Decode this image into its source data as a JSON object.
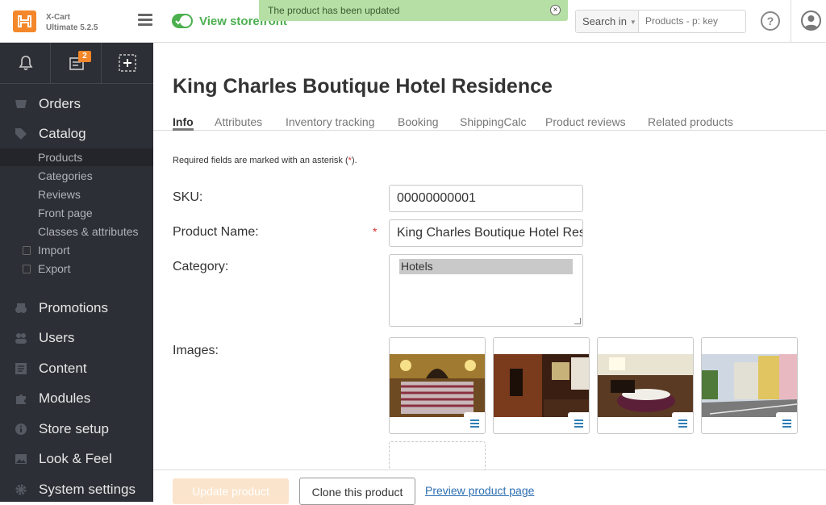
{
  "header": {
    "brand_line1": "X-Cart",
    "brand_line2": "Ultimate 5.2.5",
    "storefront_label": "View storefront",
    "notice": "The product has been updated",
    "notice_close": "×",
    "search_scope": "Search in",
    "search_placeholder": "Products - p: key",
    "help_label": "?"
  },
  "quick_bar": {
    "badge_count": "2"
  },
  "sidebar": {
    "items": [
      {
        "label": "Orders",
        "icon": "orders-icon"
      },
      {
        "label": "Catalog",
        "icon": "tag-icon"
      },
      {
        "label": "Promotions",
        "icon": "promotions-icon"
      },
      {
        "label": "Users",
        "icon": "users-icon"
      },
      {
        "label": "Content",
        "icon": "content-icon"
      },
      {
        "label": "Modules",
        "icon": "puzzle-icon"
      },
      {
        "label": "Store setup",
        "icon": "info-icon"
      },
      {
        "label": "Look & Feel",
        "icon": "image-icon"
      },
      {
        "label": "System settings",
        "icon": "gear-icon"
      }
    ],
    "catalog_sub": [
      {
        "label": "Products",
        "active": true
      },
      {
        "label": "Categories"
      },
      {
        "label": "Reviews"
      },
      {
        "label": "Front page"
      },
      {
        "label": "Classes & attributes"
      },
      {
        "label": "Import"
      },
      {
        "label": "Export"
      }
    ]
  },
  "main": {
    "title": "King Charles Boutique Hotel Residence",
    "tabs": [
      {
        "label": "Info",
        "active": true
      },
      {
        "label": "Attributes"
      },
      {
        "label": "Inventory tracking"
      },
      {
        "label": "Booking"
      },
      {
        "label": "ShippingCalc"
      },
      {
        "label": "Product reviews"
      },
      {
        "label": "Related products"
      }
    ],
    "required_note_pre": "Required fields are marked with an asterisk (",
    "required_note_ast": "*",
    "required_note_post": ").",
    "form": {
      "sku_label": "SKU:",
      "sku_value": "00000000001",
      "name_label": "Product Name:",
      "name_value": "King Charles Boutique Hotel Residence",
      "required_star": "*",
      "category_label": "Category:",
      "category_selected": "Hotels",
      "images_label": "Images:"
    }
  },
  "actions": {
    "update_label": "Update product",
    "clone_label": "Clone this product",
    "preview_label": "Preview product page"
  },
  "colors": {
    "accent_orange": "#f4872a",
    "success_green": "#4caf50",
    "notice_bg": "#b6dfa6",
    "sidebar_bg": "#2c2f35",
    "link_blue": "#2d6fb2"
  }
}
